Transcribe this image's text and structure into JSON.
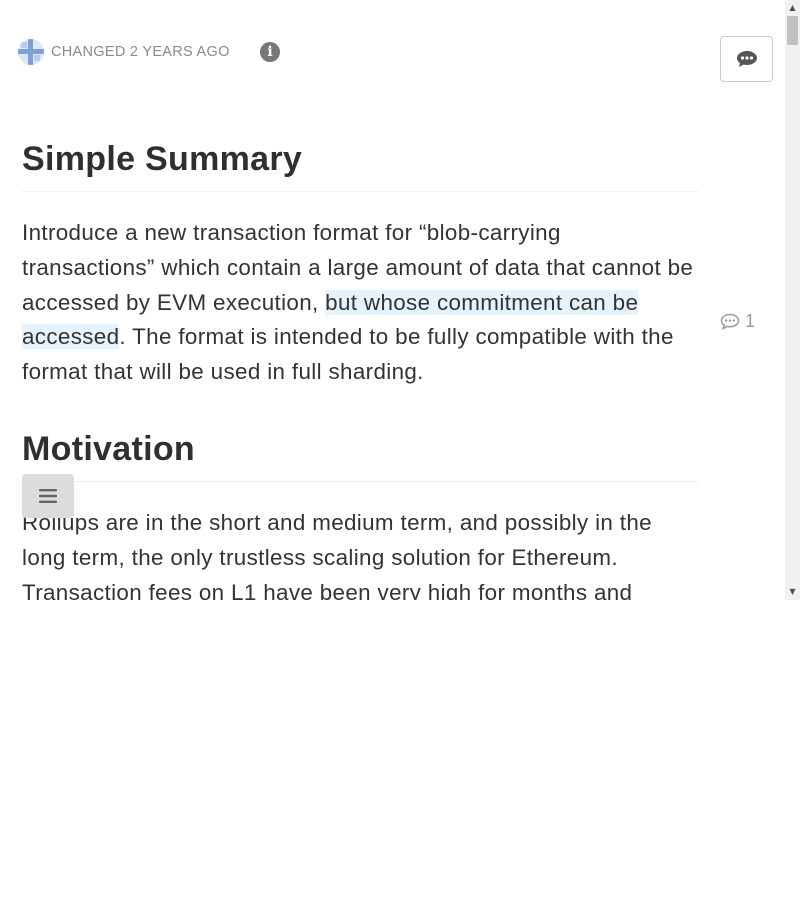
{
  "meta": {
    "changed_text": "CHANGED 2 YEARS AGO"
  },
  "sections": [
    {
      "heading": "Simple Summary",
      "paragraph": {
        "before": "Introduce a new transaction format for “blob-carrying transactions” which contain a large amount of data that cannot be accessed by EVM execution, ",
        "highlight": "but whose commitment can be accessed",
        "after": ". The format is intended to be fully compatible with the format that will be used in full sharding."
      }
    },
    {
      "heading": "Motivation",
      "paragraph": {
        "text": "Rollups are in the short and medium term, and possibly in the long term, the only trustless scaling solution for Ethereum. Transaction fees on L1 have been very high for months and"
      }
    }
  ],
  "comments": {
    "count": "1"
  },
  "icons": {
    "avatar": "avatar-icon",
    "info": "info-icon",
    "comment": "comment-bubble-icon",
    "menu": "hamburger-menu-icon"
  },
  "colors": {
    "highlight": "#e6f2fc",
    "muted": "#8a8a8a"
  }
}
